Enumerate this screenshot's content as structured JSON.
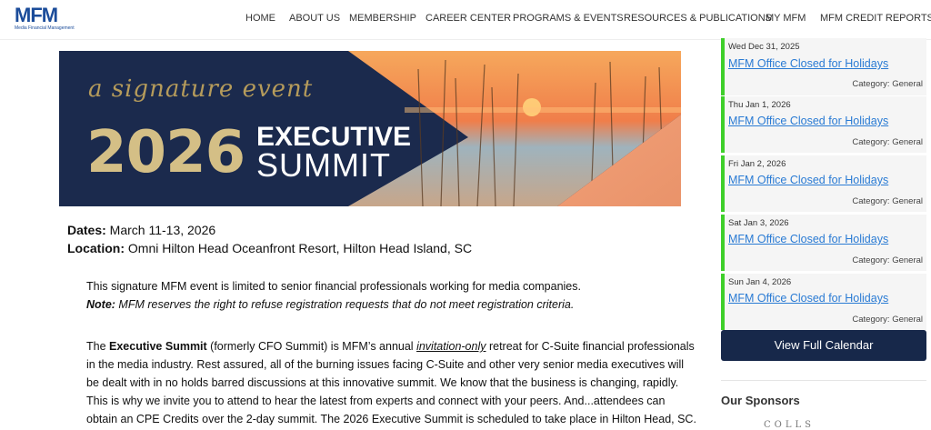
{
  "logo": {
    "mark": "MFM",
    "tagline": "Media Financial Management"
  },
  "nav": [
    {
      "label": "HOME"
    },
    {
      "label": "ABOUT US"
    },
    {
      "label": "MEMBERSHIP"
    },
    {
      "label": "CAREER CENTER"
    },
    {
      "label": "PROGRAMS & EVENTS"
    },
    {
      "label": "RESOURCES & PUBLICATIONS"
    },
    {
      "label": "MY MFM"
    },
    {
      "label": "MFM CREDIT REPORTS"
    }
  ],
  "banner": {
    "signature": "a signature event",
    "year": "2026",
    "line1": "EXECUTIVE",
    "line2": "SUMMIT",
    "colors": {
      "navy": "#1b2a4d",
      "gold": "#d4bf86",
      "peach": "#e9936a"
    }
  },
  "details": {
    "dates_label": "Dates:",
    "dates_value": " March 11-13, 2026",
    "location_label": "Location:",
    "location_value": " Omni Hilton Head Oceanfront Resort, Hilton Head Island, SC"
  },
  "intro": {
    "line1": "This signature MFM event is limited to senior financial professionals working for media companies.",
    "note_label": "Note:",
    "note_text": " MFM reserves the right to refuse registration requests that do not meet registration criteria."
  },
  "body": {
    "part1": "The ",
    "bold": "Executive Summit",
    "part2": " (formerly CFO Summit) is MFM’s annual ",
    "underline": "invitation-only",
    "part3": " retreat for C-Suite financial professionals",
    "line2": "in the media industry. Rest assured, all of the burning issues facing C-Suite and other very senior media executives will",
    "line3": "be dealt with in no holds barred discussions at this innovative summit. We know that the business is changing, rapidly.",
    "line4": "This is why we invite you to attend to hear the latest from experts and connect with your peers. And...attendees can",
    "line5": "obtain an CPE Credits over the 2-day summit. The 2026 Executive Summit is scheduled to take place in Hilton Head, SC."
  },
  "events": [
    {
      "date": "Wed Dec 31, 2025",
      "title": "MFM Office Closed for Holidays",
      "category": "Category: General"
    },
    {
      "date": "Thu Jan 1, 2026",
      "title": "MFM Office Closed for Holidays",
      "category": "Category: General"
    },
    {
      "date": "Fri Jan 2, 2026",
      "title": "MFM Office Closed for Holidays",
      "category": "Category: General"
    },
    {
      "date": "Sat Jan 3, 2026",
      "title": "MFM Office Closed for Holidays",
      "category": "Category: General"
    },
    {
      "date": "Sun Jan 4, 2026",
      "title": "MFM Office Closed for Holidays",
      "category": "Category: General"
    }
  ],
  "calendar_button": "View Full Calendar",
  "sponsors_heading": "Our Sponsors",
  "sponsor_logo_text": "COLLS"
}
